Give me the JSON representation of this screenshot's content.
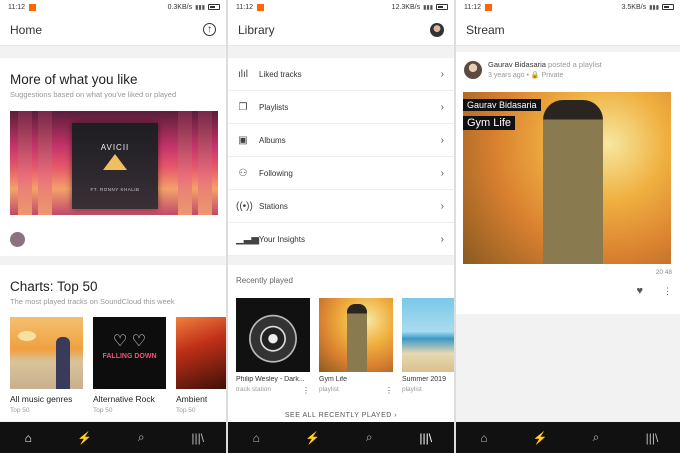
{
  "status_bars": [
    {
      "time": "11:12",
      "speed": "0.3KB/s"
    },
    {
      "time": "11:12",
      "speed": "12.3KB/s"
    },
    {
      "time": "11:12",
      "speed": "3.5KB/s"
    }
  ],
  "home": {
    "title": "Home",
    "more": {
      "title": "More of what you like",
      "subtitle": "Suggestions based on what you've liked or played",
      "art_logo": "AVICII",
      "art_caption": "FT. RONNY KHALIB"
    },
    "charts": {
      "title": "Charts: Top 50",
      "subtitle": "The most played tracks on SoundCloud this week",
      "tiles": [
        {
          "name": "All music genres",
          "meta": "Top 50"
        },
        {
          "name": "Alternative Rock",
          "meta": "Top 50"
        },
        {
          "name": "Ambient",
          "meta": "Top 50"
        }
      ],
      "tile2_text": "FALLING DOWN"
    }
  },
  "library": {
    "title": "Library",
    "items": [
      {
        "label": "Liked tracks",
        "icon": "waveform-icon"
      },
      {
        "label": "Playlists",
        "icon": "playlists-icon"
      },
      {
        "label": "Albums",
        "icon": "album-icon"
      },
      {
        "label": "Following",
        "icon": "following-icon"
      },
      {
        "label": "Stations",
        "icon": "stations-icon"
      },
      {
        "label": "Your Insights",
        "icon": "insights-icon"
      }
    ],
    "recent": {
      "title": "Recently played",
      "tiles": [
        {
          "name": "Philip Wesley - Dark...",
          "meta": "track station"
        },
        {
          "name": "Gym Life",
          "meta": "playlist"
        },
        {
          "name": "Summer 2019",
          "meta": "playlist"
        }
      ],
      "see_all": "SEE ALL RECENTLY PLAYED ›"
    }
  },
  "stream": {
    "title": "Stream",
    "post": {
      "user": "Gaurav Bidasaria",
      "action": "posted a playlist",
      "time": "3 years ago • 🔒 Private",
      "art_user": "Gaurav Bidasaria",
      "art_title": "Gym Life",
      "duration": "20:48"
    }
  },
  "nav": {
    "home": "⌂",
    "stream": "⚡",
    "search": "⌕",
    "library": "|||\\"
  },
  "colors": {
    "accent": "#ff5500",
    "nav_bg": "#111111"
  }
}
